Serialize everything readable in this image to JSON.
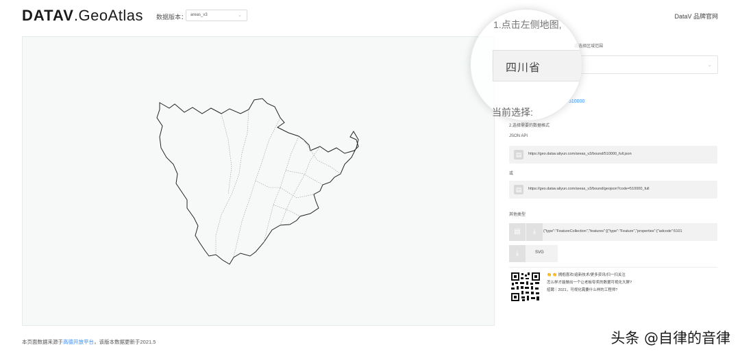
{
  "header": {
    "logo_bold": "DATAV",
    "logo_light": ".GeoAtlas",
    "version_label": "数据版本：",
    "version_value": "areas_v3",
    "brand_link": "DataV 品牌官网"
  },
  "region_picker": {
    "step_text": "1.点击左侧地图,",
    "hint": "或选择区域范围",
    "selected_region": "四川省",
    "region_code": "510000"
  },
  "current": {
    "label": "当前选择:",
    "format_label": "2.选择需要的数据格式",
    "json_api_label": "JSON API",
    "or_label": "或",
    "api_url_1": "https://geo.datav.aliyun.com/areas_v3/bound/510000_full.json",
    "api_url_2": "https://geo.datav.aliyun.com/areas_v3/bound/geojson?code=510000_full",
    "other_label": "其他类型",
    "geojson_preview": "{\"type\":\"FeatureCollection\",\"features\":[{\"type\":\"Feature\",\"properties\":{\"adcode\":5101",
    "svg_label": "SVG"
  },
  "promo": {
    "line_1": "👏 👏 拥抱喜欢/追新技术/更多资讯/扫一扫关注",
    "line_2": "怎么样才能做出一个让老板夸奖的数据可视化大屏?",
    "line_3": "招聘｜2021，可视化需要什么样的工程师?"
  },
  "footer": {
    "prefix": "本页面数据来源于",
    "link": "高德开放平台",
    "suffix": "，该版本数据更新于2021.5"
  },
  "watermark": "头条 @自律的音律",
  "colors": {
    "link": "#2f8cff",
    "map_bg": "#f6f9f8",
    "row_bg": "#f2f2f2"
  },
  "icons": [
    "chevron-down-icon",
    "file-icon",
    "download-icon",
    "qr-code-icon"
  ]
}
